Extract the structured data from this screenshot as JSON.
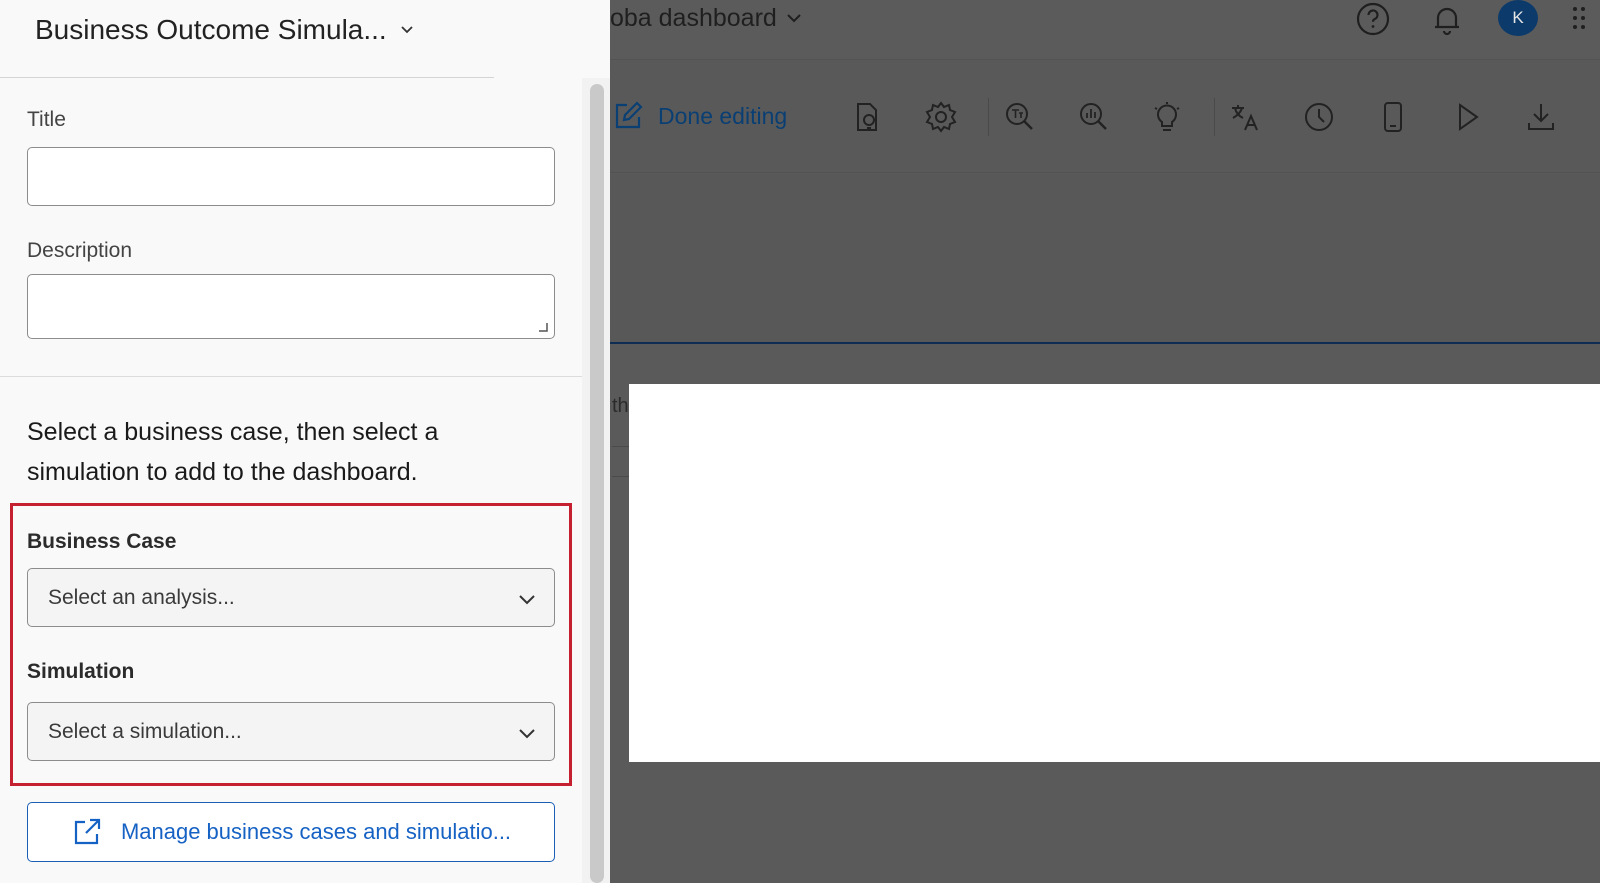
{
  "dashboard": {
    "title": "oba dashboard",
    "avatar_initial": "K",
    "ghost_text": "th",
    "toolbar": {
      "done_editing_label": "Done editing"
    }
  },
  "panel": {
    "title": "Business Outcome Simula...",
    "title_field": {
      "label": "Title",
      "value": ""
    },
    "description_field": {
      "label": "Description",
      "value": ""
    },
    "instruction": "Select a business case, then select a simulation to add to the dashboard.",
    "business_case": {
      "label": "Business Case",
      "placeholder": "Select an analysis..."
    },
    "simulation": {
      "label": "Simulation",
      "placeholder": "Select a simulation..."
    },
    "manage_button_label": "Manage business cases and simulatio..."
  },
  "colors": {
    "highlight": "#c4202f",
    "link_blue": "#1662c4",
    "overlay": "#5a5a5a"
  }
}
